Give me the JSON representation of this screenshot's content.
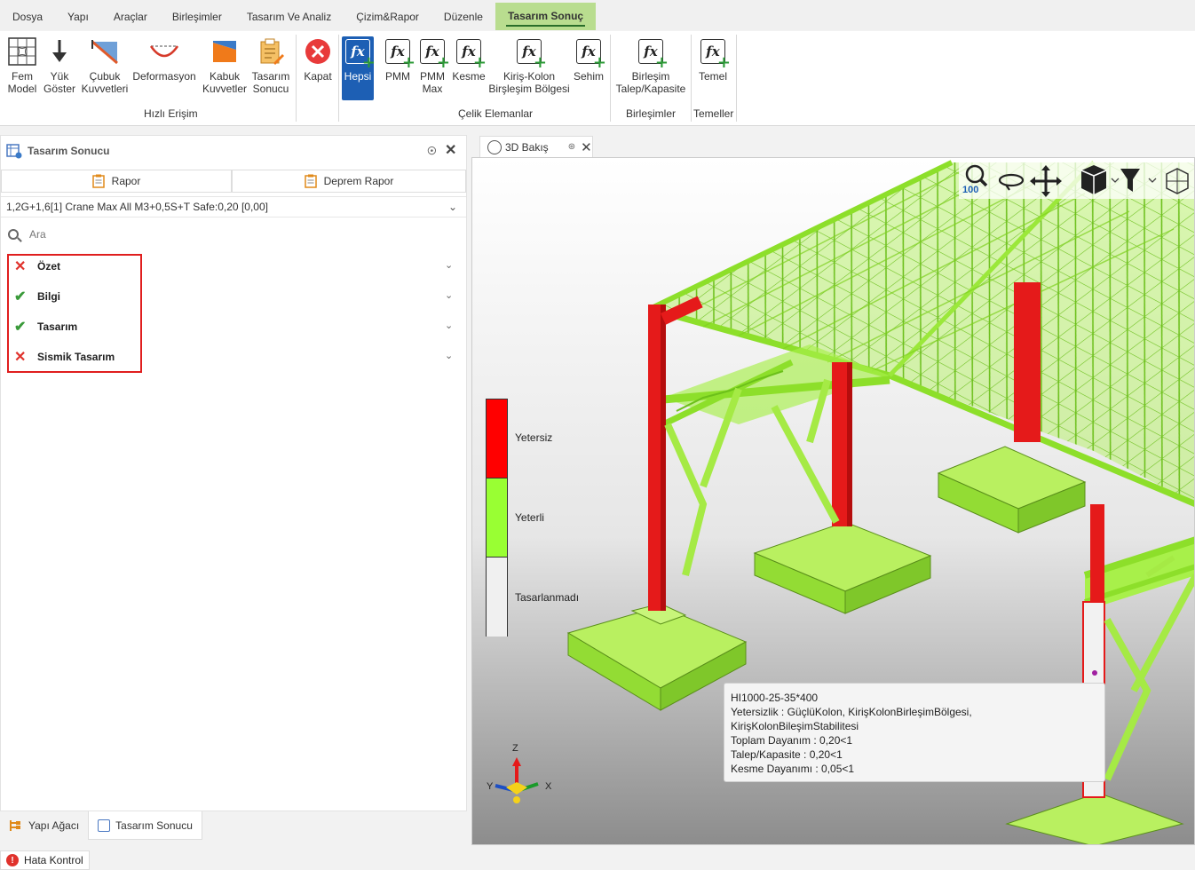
{
  "menu": [
    "Dosya",
    "Yapı",
    "Araçlar",
    "Birleşimler",
    "Tasarım Ve Analiz",
    "Çizim&Rapor",
    "Düzenle",
    "Tasarım Sonuç"
  ],
  "ribbon": {
    "quick": [
      {
        "l1": "Fem",
        "l2": "Model",
        "icon": "fem-model-icon"
      },
      {
        "l1": "Yük",
        "l2": "Göster",
        "icon": "load-arrow-icon"
      },
      {
        "l1": "Çubuk",
        "l2": "Kuvvetleri",
        "icon": "member-forces-icon"
      },
      {
        "l1": "Deformasyon",
        "l2": "",
        "icon": "deformation-icon"
      },
      {
        "l1": "Kabuk",
        "l2": "Kuvvetler",
        "icon": "shell-forces-icon"
      },
      {
        "l1": "Tasarım",
        "l2": "Sonucu",
        "icon": "design-result-icon"
      }
    ],
    "close_label": "Kapat",
    "group_quick": "Hızlı Erişim",
    "steel": [
      {
        "l1": "Hepsi",
        "l2": ""
      },
      {
        "l1": "PMM",
        "l2": ""
      },
      {
        "l1": "PMM",
        "l2": "Max"
      },
      {
        "l1": "Kesme",
        "l2": ""
      },
      {
        "l1": "Kiriş-Kolon",
        "l2": "Birşleşim Bölgesi"
      },
      {
        "l1": "Sehim",
        "l2": ""
      }
    ],
    "group_steel": "Çelik Elemanlar",
    "conn": {
      "l1": "Birleşim",
      "l2": "Talep/Kapasite"
    },
    "group_conn": "Birleşimler",
    "found": {
      "l1": "Temel",
      "l2": ""
    },
    "group_found": "Temeller"
  },
  "panel": {
    "title": "Tasarım Sonucu",
    "rapor": "Rapor",
    "deprem_rapor": "Deprem Rapor",
    "combo": "1,2G+1,6[1] Crane Max All M3+0,5S+T Safe:0,20 [0,00]",
    "search_placeholder": "Ara",
    "items": [
      {
        "label": "Özet",
        "status": "fail"
      },
      {
        "label": "Bilgi",
        "status": "ok"
      },
      {
        "label": "Tasarım",
        "status": "ok"
      },
      {
        "label": "Sismik Tasarım",
        "status": "fail"
      }
    ]
  },
  "bottom_tabs": [
    "Yapı Ağacı",
    "Tasarım Sonucu"
  ],
  "status": {
    "error_label": "Hata Kontrol"
  },
  "view": {
    "tab_title": "3D Bakış",
    "zoom": "100",
    "legend": [
      {
        "label": "Yetersiz",
        "color": "#ff0000"
      },
      {
        "label": "Yeterli",
        "color": "#99ff33"
      },
      {
        "label": "Tasarlanmadı",
        "color": "#f0f0f0"
      }
    ],
    "axes": {
      "z": "Z",
      "y": "Y",
      "x": "X"
    },
    "tooltip": [
      "HI1000-25-35*400",
      "Yetersizlik : GüçlüKolon, KirişKolonBirleşimBölgesi, KirişKolonBileşimStabilitesi",
      "Toplam Dayanım : 0,20<1",
      "Talep/Kapasite : 0,20<1",
      "Kesme Dayanımı : 0,05<1"
    ]
  },
  "colors": {
    "accent_tab": "#b9dd8f",
    "selected_button": "#1d5fb4",
    "fail": "#e0322c",
    "ok": "#3a9a3a",
    "structure_green": "#9cf02a",
    "structure_red": "#e51a1a"
  }
}
